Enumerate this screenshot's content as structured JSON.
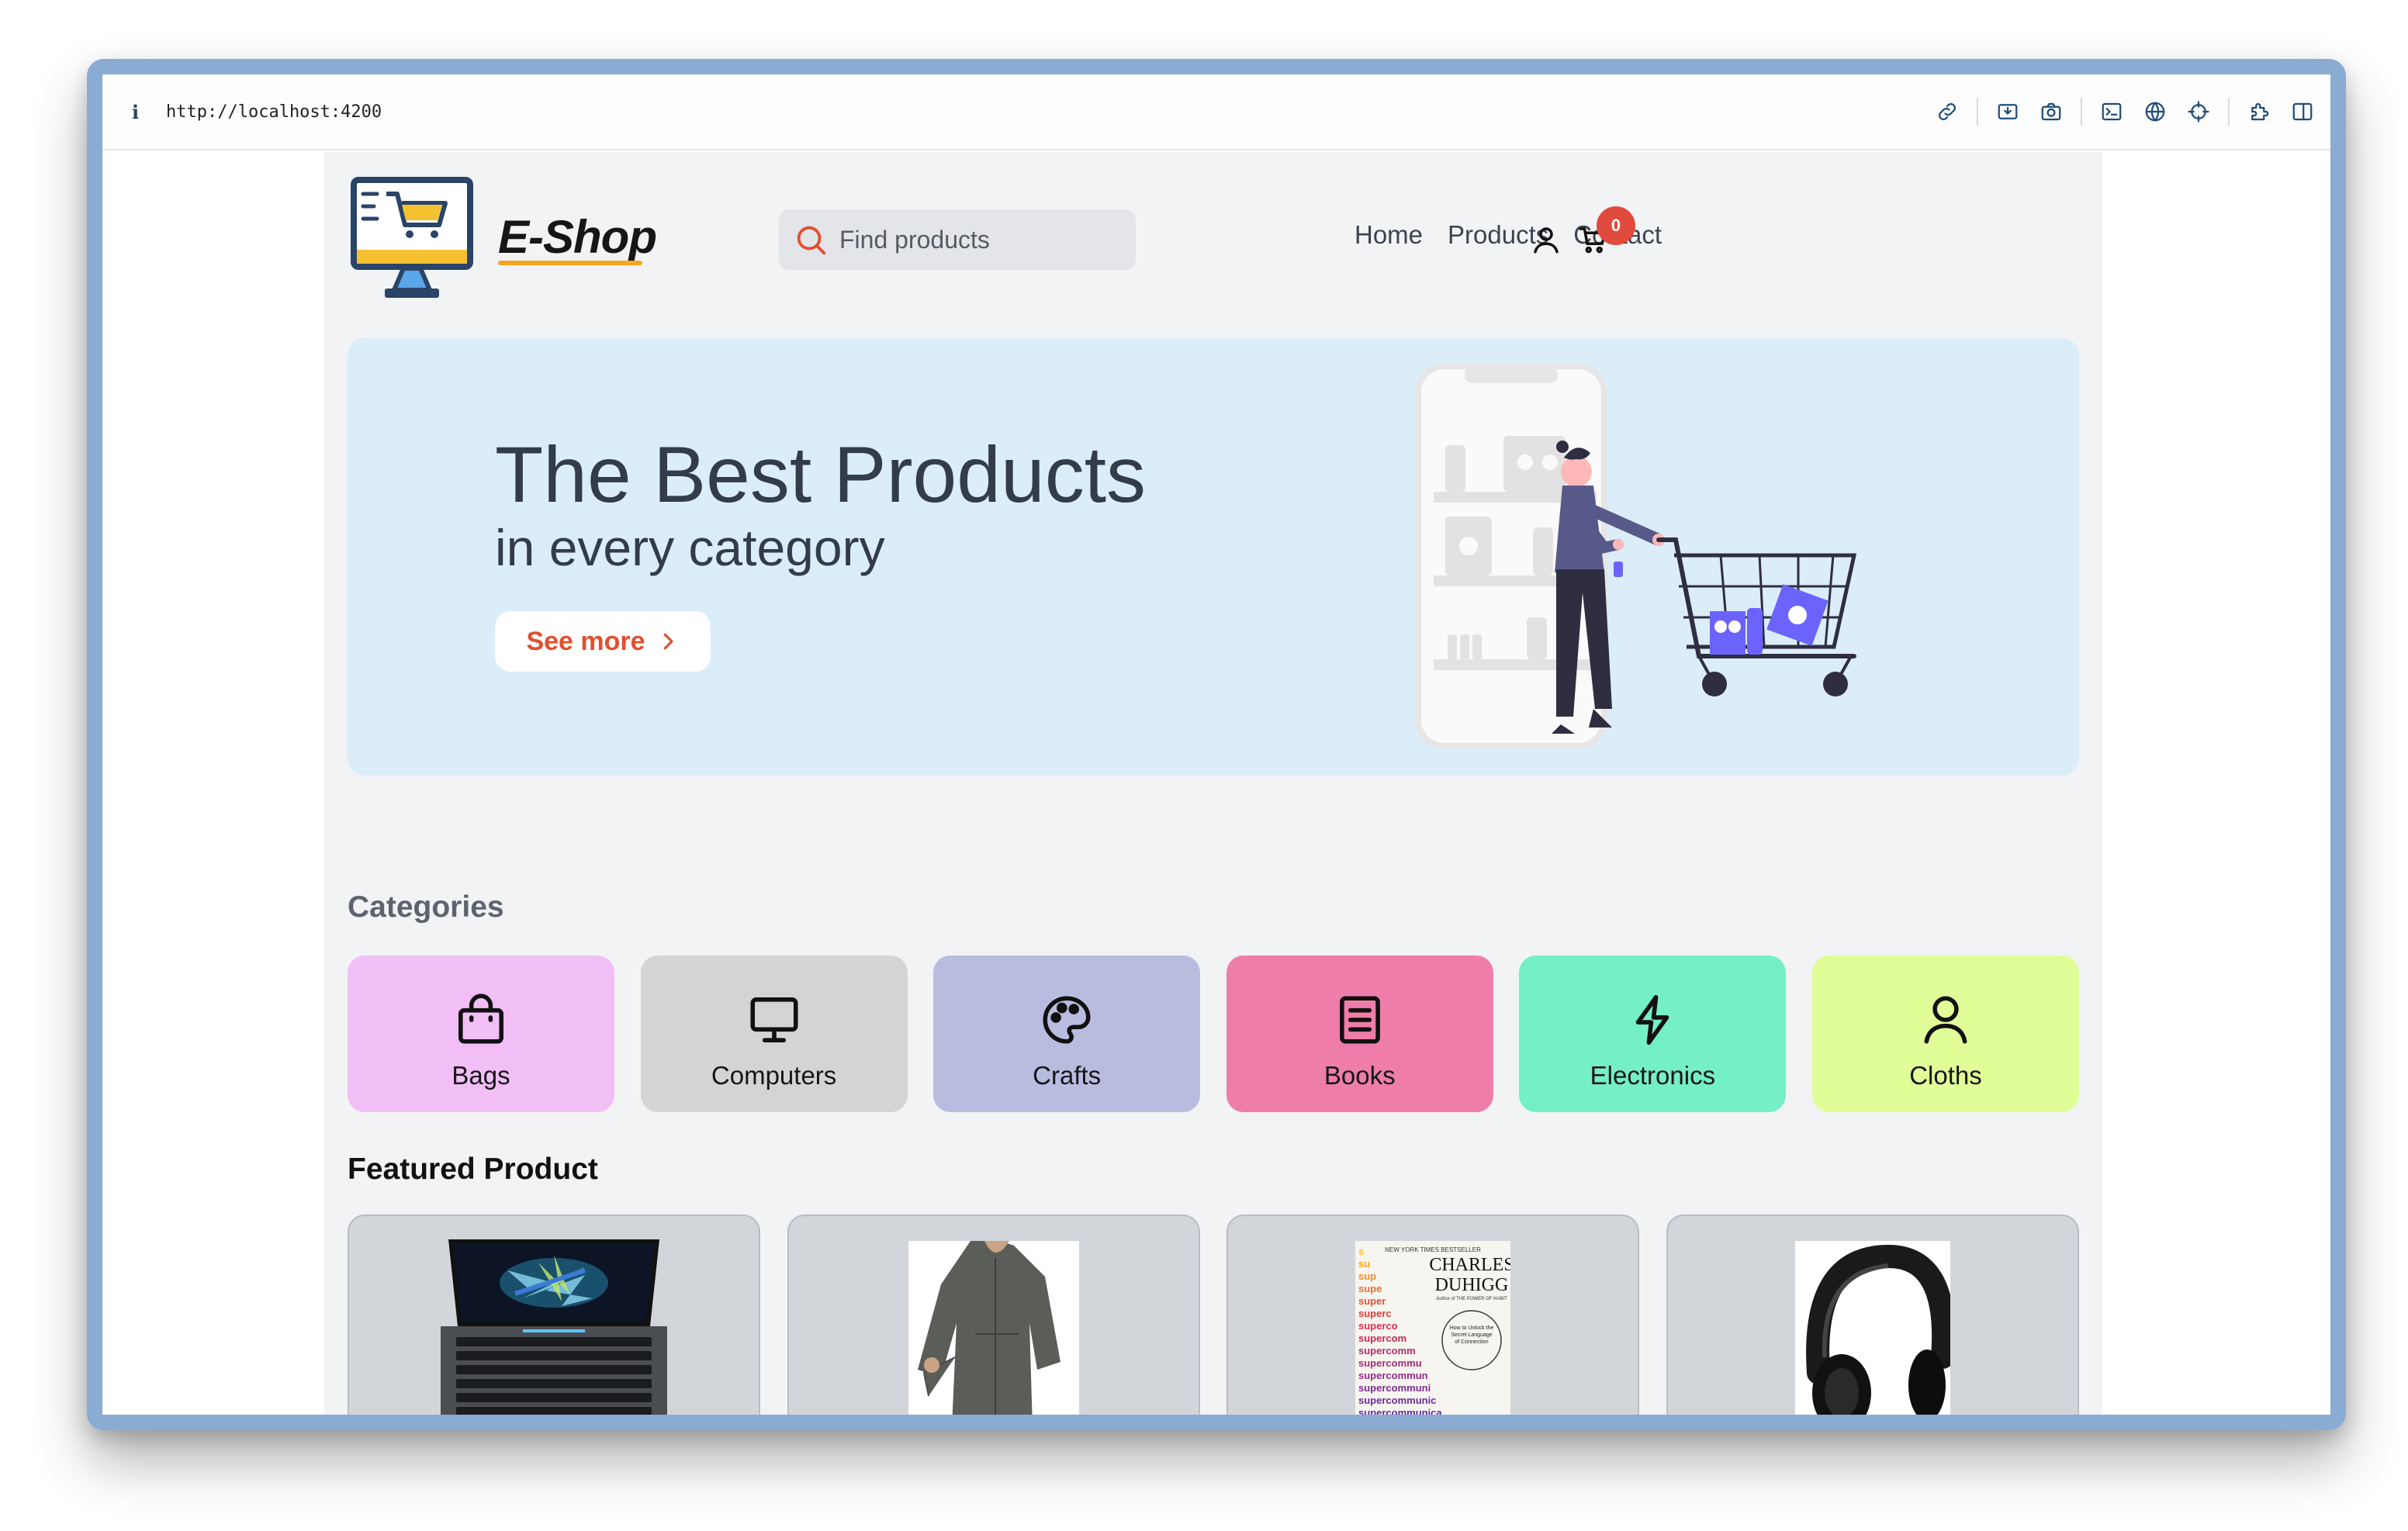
{
  "browser": {
    "info_icon": "i",
    "url": "http://localhost:4200",
    "toolbar_icons": [
      "link-icon",
      "download-icon",
      "camera-icon",
      "terminal-icon",
      "globe-icon",
      "crosshair-icon",
      "extension-icon",
      "sidebar-icon"
    ]
  },
  "header": {
    "brand": "E-Shop",
    "search_placeholder": "Find products",
    "nav": [
      "Home",
      "Products",
      "Contact"
    ],
    "cart_count": "0"
  },
  "hero": {
    "title": "The Best Products",
    "subtitle": "in every category",
    "button_label": "See more"
  },
  "categories_title": "Categories",
  "categories": [
    {
      "label": "Bags",
      "icon": "bag-icon",
      "color": "#f2bef6"
    },
    {
      "label": "Computers",
      "icon": "monitor-icon",
      "color": "#d3d4d6"
    },
    {
      "label": "Crafts",
      "icon": "palette-icon",
      "color": "#b8bde0"
    },
    {
      "label": "Books",
      "icon": "book-icon",
      "color": "#ef7da9"
    },
    {
      "label": "Electronics",
      "icon": "lightning-icon",
      "color": "#74efc8"
    },
    {
      "label": "Cloths",
      "icon": "person-icon",
      "color": "#e0fd98"
    }
  ],
  "featured_title": "Featured Product",
  "featured_products": [
    {
      "image": "laptop"
    },
    {
      "image": "jacket"
    },
    {
      "image": "book-cover",
      "author_first": "CHARLES",
      "author_last": "DUHIGG",
      "banner": "NEW YORK TIMES BESTSELLER",
      "byline": "Author of THE POWER OF HABIT",
      "circle_text": "How to Unlock the Secret Language of Connection",
      "word_lines": [
        "s",
        "su",
        "sup",
        "supe",
        "super",
        "superc",
        "superco",
        "supercom",
        "supercomm",
        "supercommu",
        "supercommun",
        "supercommuni",
        "supercommunic",
        "supercommunica"
      ]
    },
    {
      "image": "headphones"
    }
  ],
  "colors": {
    "accent": "#e0502f",
    "badge": "#e04b3d",
    "hero_bg": "#dbedf9",
    "page_bg": "#f2f3f5"
  }
}
